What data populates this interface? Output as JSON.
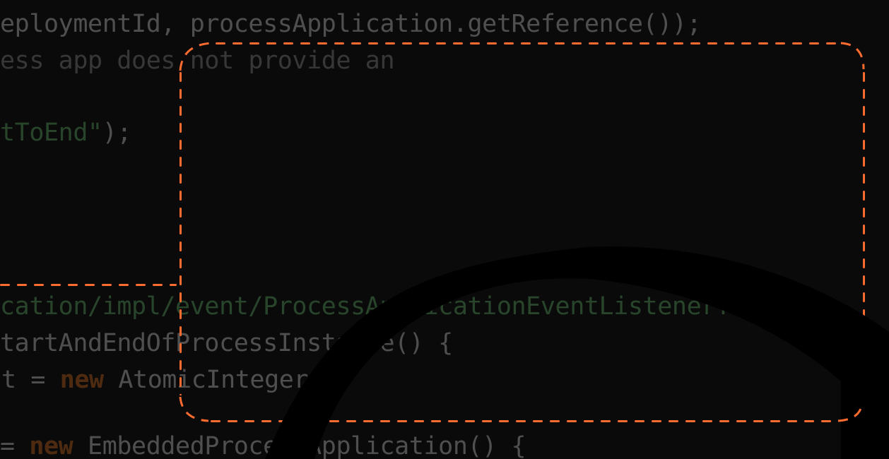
{
  "editor": {
    "lines": [
      {
        "tokens": [
          {
            "text": "eploymentId, processApplication.getReference());",
            "kind": "plain"
          }
        ]
      },
      {
        "tokens": [
          {
            "text": "ess app does not provide an",
            "kind": "dim"
          }
        ]
      },
      {
        "tokens": [
          {
            "text": "tToEnd\"",
            "kind": "str"
          },
          {
            "text": ");",
            "kind": "plain"
          }
        ]
      },
      {
        "tokens": [
          {
            "text": "cation/impl/event/ProcessApplicationEventListenerTest.te",
            "kind": "str"
          }
        ]
      },
      {
        "tokens": [
          {
            "text": "tartAndEndOfProcessInstance() {",
            "kind": "plain"
          }
        ]
      },
      {
        "tokens": [
          {
            "text": "t = ",
            "kind": "plain"
          },
          {
            "text": "new",
            "kind": "kw"
          },
          {
            "text": " AtomicInteger();",
            "kind": "plain"
          }
        ]
      },
      {
        "tokens": [
          {
            "text": "= ",
            "kind": "plain"
          },
          {
            "text": "new",
            "kind": "kw"
          },
          {
            "text": " EmbeddedProcessApplication() {",
            "kind": "plain"
          }
        ]
      }
    ]
  },
  "annotation": {
    "color": "#ff6c2f",
    "shape": "dashed-rounded-rectangle-with-leader-line"
  },
  "ring": {
    "color": "#000000"
  }
}
